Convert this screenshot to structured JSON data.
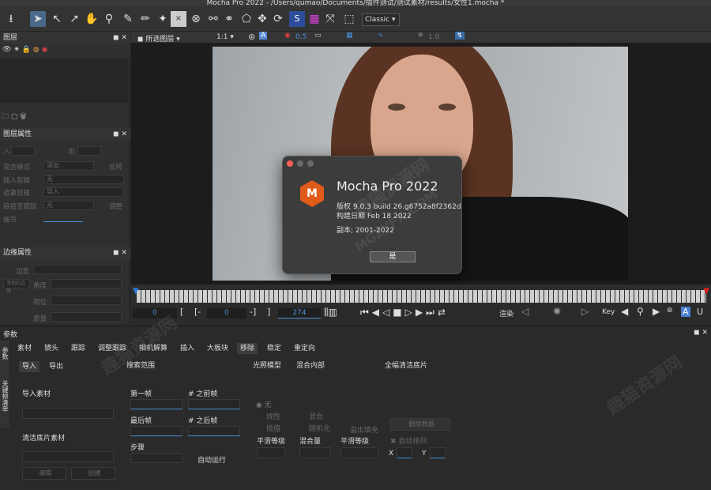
{
  "window": {
    "title": "Mocha Pro 2022 - /Users/qumao/Documents/插件测试/测试素材/results/女性1.mocha *"
  },
  "toolbar": {
    "workspace": "Classic"
  },
  "viewer_bar": {
    "layer_select": "所选图层",
    "zoom": "1:1",
    "opacity": "0.5",
    "value2": "1.0"
  },
  "layers_panel": {
    "title": "图层"
  },
  "layer_props": {
    "title": "图层属性",
    "in_label": "入",
    "out_label": "出",
    "blend_mode_label": "混合模式",
    "blend_mode_value": "添加",
    "invert_label": "反转",
    "insert_clip_label": "插入剪辑",
    "insert_clip_value": "无",
    "matte_clip_label": "遮罩剪辑",
    "matte_clip_value": "导入",
    "link_track_label": "链接至跟踪",
    "link_track_value": "无",
    "adjust_label": "调整",
    "detail_label": "细节"
  },
  "edge_props": {
    "title": "边缘属性",
    "edge_width_label": "边宽",
    "edge_width_btn": "添加的边缘",
    "angle_label": "角度",
    "phase_label": "相位",
    "mass_label": "质量"
  },
  "timeline": {
    "in_frame": "0",
    "current_frame": "0",
    "out_frame": "274",
    "render_label": "渲染",
    "key_label": "Key"
  },
  "params": {
    "title": "参数",
    "tabs": [
      "素材",
      "镜头",
      "跟踪",
      "调整跟踪",
      "相机解算",
      "插入",
      "大板块",
      "移除",
      "稳定",
      "重定向"
    ],
    "side_tabs": [
      "参数",
      "关键帧清单"
    ],
    "subtabs": [
      "导入",
      "导出"
    ],
    "import_clip_label": "导入素材",
    "clean_plate_label": "清洁底片素材",
    "import_btn": "编辑",
    "remove_btn": "创建",
    "search_area": "搜索范围",
    "first_frame": "第一帧",
    "prev_frame": "# 之前帧",
    "last_frame": "最后帧",
    "next_frame": "# 之后帧",
    "step_label": "步骤",
    "auto_run": "自动运行",
    "lighting_model": "光照模型",
    "blend_inside": "混合内部",
    "light_none": "无",
    "light_linear": "线性",
    "light_interp": "插值",
    "blend_mix": "混合",
    "blend_random": "随机化",
    "overflow_fill": "溢出填充",
    "smooth_level": "平滑等级",
    "blend_amount": "混合量",
    "smooth_level2": "平滑等级",
    "full_clean": "全幅清洁底片",
    "clear_btn": "删除数据",
    "auto_align": "自动排列",
    "x_label": "X",
    "y_label": "Y"
  },
  "dialog": {
    "product": "Mocha Pro 2022",
    "version": "版权 9.0.3 build 26.g6752a8f2362d",
    "build_date": "构建日期 Feb 18 2022",
    "copyright": "副本; 2001-2022",
    "ok_button": "是"
  },
  "watermark": {
    "text_cn": "趣猫资源网",
    "text_en": "MGZYFX.COM"
  },
  "colors": {
    "accent": "#4a90d9",
    "logo": "#e05a1a"
  }
}
